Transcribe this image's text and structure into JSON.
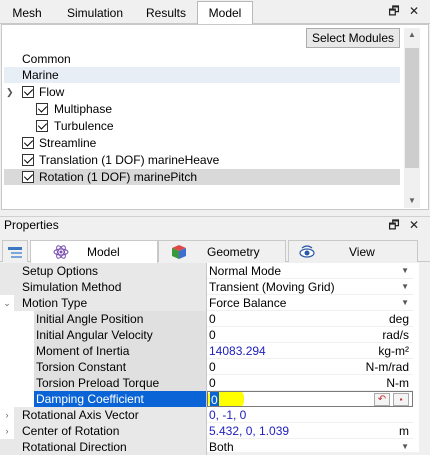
{
  "top_tabs": [
    "Mesh",
    "Simulation",
    "Results",
    "Model"
  ],
  "top_window_btns": [
    "🗗",
    "✕"
  ],
  "select_modules_label": "Select Modules",
  "tree": [
    {
      "label": "Common",
      "checkbox": false
    },
    {
      "label": "Marine",
      "checkbox": false
    },
    {
      "label": "Flow",
      "checkbox": true
    },
    {
      "label": "Multiphase",
      "checkbox": true
    },
    {
      "label": "Turbulence",
      "checkbox": true
    },
    {
      "label": "Streamline",
      "checkbox": true
    },
    {
      "label": "Translation (1 DOF) marineHeave",
      "checkbox": true
    },
    {
      "label": "Rotation (1 DOF) marinePitch",
      "checkbox": true
    }
  ],
  "properties_title": "Properties",
  "props_window_btns": [
    "🗗",
    "✕"
  ],
  "prop_tabs": [
    "Model",
    "Geometry",
    "View"
  ],
  "props": {
    "setup_options": {
      "name": "Setup Options",
      "value": "Normal Mode"
    },
    "simulation_method": {
      "name": "Simulation Method",
      "value": "Transient (Moving Grid)"
    },
    "motion_type": {
      "name": "Motion Type",
      "value": "Force Balance"
    },
    "initial_angle": {
      "name": "Initial Angle Position",
      "value": "0",
      "unit": "deg"
    },
    "initial_angular_velocity": {
      "name": "Initial Angular Velocity",
      "value": "0",
      "unit": "rad/s"
    },
    "moment_of_inertia": {
      "name": "Moment of Inertia",
      "value": "14083.294",
      "unit": "kg-m²"
    },
    "torsion_constant": {
      "name": "Torsion Constant",
      "value": "0",
      "unit": "N-m/rad"
    },
    "torsion_preload": {
      "name": "Torsion Preload Torque",
      "value": "0",
      "unit": "N-m"
    },
    "damping_coefficient": {
      "name": "Damping Coefficient",
      "value": "0"
    },
    "rotational_axis_vector": {
      "name": "Rotational Axis Vector",
      "value": "0, -1, 0"
    },
    "center_of_rotation": {
      "name": "Center of Rotation",
      "value": "5.432, 0, 1.039",
      "unit": "m"
    },
    "rotational_direction": {
      "name": "Rotational Direction",
      "value": "Both"
    }
  },
  "colors": {
    "selection": "#0a64d6",
    "highlight": "#ffff00",
    "blue_value": "#2020c0"
  }
}
